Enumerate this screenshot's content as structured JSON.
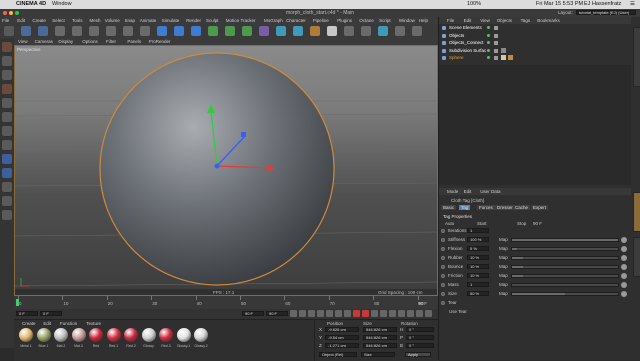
{
  "mac_menubar": {
    "app_name": "CINEMA 4D",
    "window_menu": "Window",
    "clock": "Fri Mar 15  5:53 PM",
    "user": "EJ Hassenfratz",
    "battery": "100%"
  },
  "window": {
    "title": "morph_cloth_start.c4d * - Main"
  },
  "layout": {
    "label": "Layout:",
    "value": "tutorial_template (EJ) (User)"
  },
  "main_menu": [
    "File",
    "Edit",
    "Create",
    "Select",
    "Tools",
    "Mesh",
    "Volume",
    "Snap",
    "Animate",
    "Simulate",
    "Render",
    "Sculpt",
    "Motion Tracker",
    "MoGraph",
    "Character",
    "Pipeline",
    "Plugins",
    "Octane",
    "Script",
    "Window",
    "Help"
  ],
  "viewport": {
    "menu": [
      "View",
      "Cameras",
      "Display",
      "Options",
      "Filter",
      "Panels",
      "ProRender"
    ],
    "camera_label": "Perspective",
    "fps": "FPS : 17.1",
    "grid_spacing": "Grid Spacing : 100 cm"
  },
  "timeline": {
    "ticks": [
      "0",
      "10",
      "20",
      "30",
      "40",
      "50",
      "60",
      "70",
      "80",
      "90"
    ],
    "end_frame": "90 F",
    "current_frame": "0 F",
    "start_field": "0 F",
    "end_field": "90 F",
    "end_field2": "90 F"
  },
  "materials": {
    "menu": [
      "Create",
      "Edit",
      "Function",
      "Texture"
    ],
    "items": [
      {
        "name": "Metal 1",
        "color": "#e0b770"
      },
      {
        "name": "Blue 1",
        "color": "#9aa36a"
      },
      {
        "name": "Mat.2",
        "color": "#c0c0c0"
      },
      {
        "name": "Mat.3",
        "color": "#c79b9b"
      },
      {
        "name": "Red",
        "color": "#c8283a"
      },
      {
        "name": "Red.1",
        "color": "#d2303e"
      },
      {
        "name": "Red.2",
        "color": "#c82a40"
      },
      {
        "name": "Glossy",
        "color": "#cfcfcf"
      },
      {
        "name": "Red.3",
        "color": "#cc2b3f"
      },
      {
        "name": "Glossy.1",
        "color": "#e3e3e3"
      },
      {
        "name": "Glossy.2",
        "color": "#d6d6d6"
      }
    ]
  },
  "coordinates": {
    "headers": [
      "Position",
      "Size",
      "Rotation"
    ],
    "rows": [
      {
        "axis": "X",
        "pos": "-9.826 cm",
        "size": "546.826 cm",
        "rot_axis": "H",
        "rot": "0 °"
      },
      {
        "axis": "Y",
        "pos": "-9.54 cm",
        "size": "546.826 cm",
        "rot_axis": "P",
        "rot": "0 °"
      },
      {
        "axis": "Z",
        "pos": "-1.271 cm",
        "size": "546.826 cm",
        "rot_axis": "B",
        "rot": "0 °"
      }
    ],
    "mode": "Object (Rel)",
    "size_mode": "Size",
    "apply": "Apply"
  },
  "objects": {
    "menu": [
      "File",
      "Edit",
      "View",
      "Objects",
      "Tags",
      "Bookmarks"
    ],
    "items": [
      {
        "name": "Scene Elements",
        "color": "#ffffff"
      },
      {
        "name": "Objects",
        "color": "#ffffff"
      },
      {
        "name": "Objects_Connect",
        "color": "#ffffff"
      },
      {
        "name": "Subdivision Surfac",
        "color": "#ffffff"
      },
      {
        "name": "Sphere",
        "color": "#e69a2e"
      }
    ]
  },
  "attributes": {
    "menu": [
      "Mode",
      "Edit",
      "User Data"
    ],
    "title": "Cloth Tag [Cloth]",
    "tabs": [
      "Basic",
      "Tag",
      "Forces",
      "Dresser",
      "Cache",
      "Expert"
    ],
    "section": "Tag Properties",
    "auto_label": "Auto",
    "start_label": "Start",
    "stop_label": "Stop",
    "stop_value": "90 F",
    "params": [
      {
        "name": "Iterations",
        "value": "1",
        "map": "",
        "fill": 0.0
      },
      {
        "name": "Stiffness",
        "value": "100 %",
        "map": "Map",
        "fill": 1.0
      },
      {
        "name": "Flexion",
        "value": "5 %",
        "map": "Map",
        "fill": 0.05
      },
      {
        "name": "Rubber",
        "value": "10 %",
        "map": "Map",
        "fill": 0.1
      },
      {
        "name": "Bounce",
        "value": "10 %",
        "map": "Map",
        "fill": 0.1
      },
      {
        "name": "Friction",
        "value": "10 %",
        "map": "Map",
        "fill": 0.1
      },
      {
        "name": "Mass",
        "value": "1",
        "map": "Map",
        "fill": 0.0
      },
      {
        "name": "Size",
        "value": "50 %",
        "map": "Map",
        "fill": 0.5
      },
      {
        "name": "Tear",
        "value": "",
        "map": "",
        "fill": 0.0
      }
    ],
    "use_tear": "Use Tear"
  },
  "colors": {
    "accent": "#e69a2e",
    "axis_y": "#2ecc40",
    "axis_x": "#e23c3c",
    "axis_z": "#3a5cff"
  }
}
